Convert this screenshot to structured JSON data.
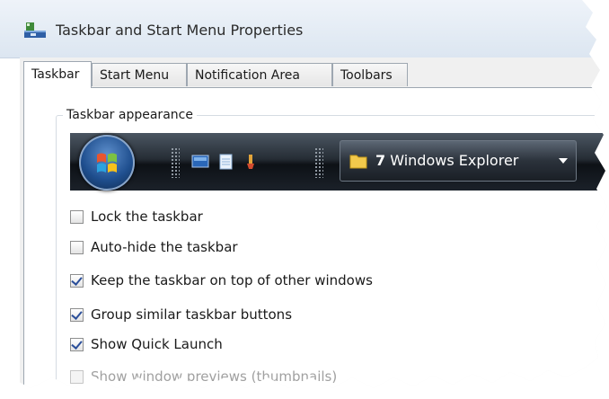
{
  "window": {
    "title": "Taskbar and Start Menu Properties",
    "icon": "taskbar-properties-icon"
  },
  "tabs": [
    {
      "label": "Taskbar",
      "active": true
    },
    {
      "label": "Start Menu",
      "active": false
    },
    {
      "label": "Notification Area",
      "active": false
    },
    {
      "label": "Toolbars",
      "active": false
    }
  ],
  "group": {
    "label": "Taskbar appearance"
  },
  "preview": {
    "start_orb": "windows-orb-icon",
    "quick_launch": [
      "show-desktop-icon",
      "notepad-icon",
      "paint-icon"
    ],
    "task_button": {
      "icon": "folder-icon",
      "count": "7",
      "label": "Windows Explorer"
    }
  },
  "options": [
    {
      "label": "Lock the taskbar",
      "checked": false,
      "enabled": true
    },
    {
      "label": "Auto-hide the taskbar",
      "checked": false,
      "enabled": true
    },
    {
      "label": "Keep the taskbar on top of other windows",
      "checked": true,
      "enabled": true
    },
    {
      "label": "Group similar taskbar buttons",
      "checked": true,
      "enabled": true
    },
    {
      "label": "Show Quick Launch",
      "checked": true,
      "enabled": true
    },
    {
      "label": "Show window previews (thumbnails)",
      "checked": false,
      "enabled": false
    }
  ],
  "colors": {
    "accent": "#2b4f9a",
    "taskbar_dark": "#1b2129",
    "disabled_text": "#a0a0a0"
  }
}
